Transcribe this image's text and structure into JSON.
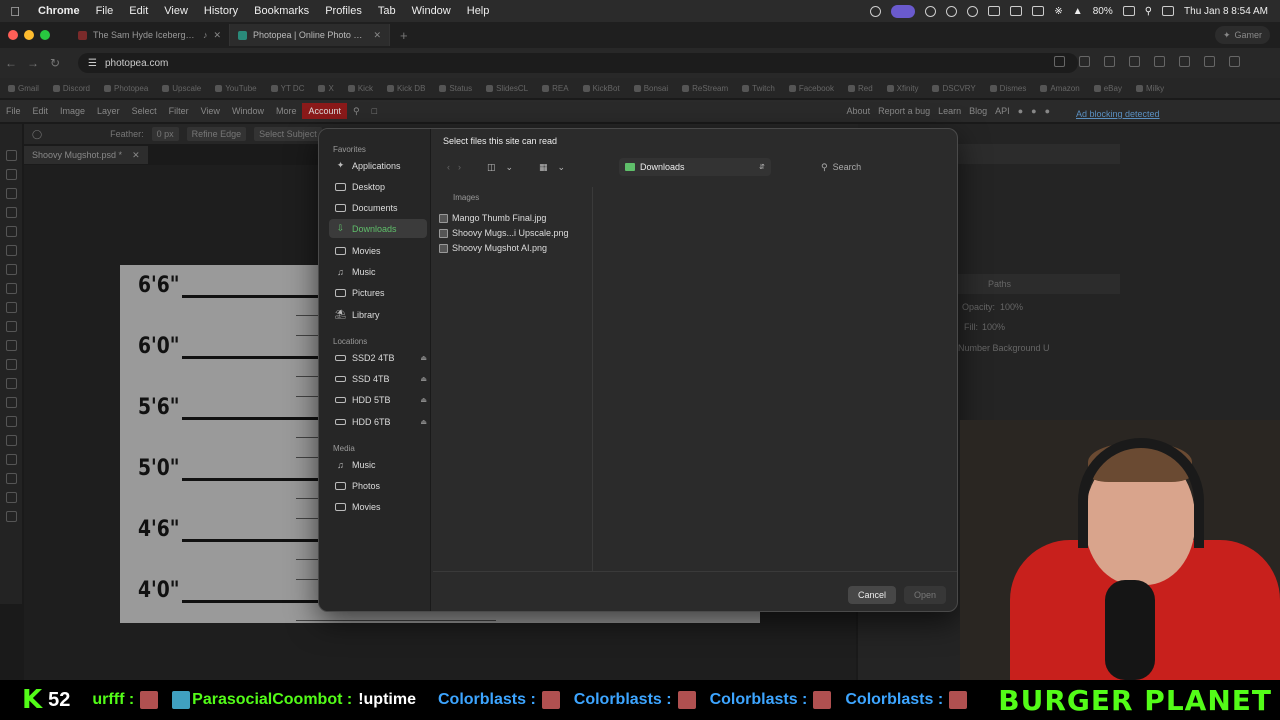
{
  "menubar": {
    "items": [
      "Chrome",
      "File",
      "Edit",
      "View",
      "History",
      "Bookmarks",
      "Profiles",
      "Tab",
      "Window",
      "Help"
    ],
    "battery": "80%",
    "datetime": "Thu Jan 8  8:54 AM"
  },
  "tabs": [
    {
      "title": "The Sam Hyde Iceberg Ex"
    },
    {
      "title": "Photopea | Online Photo Edit"
    }
  ],
  "profile_chip": "Gamer",
  "address": "photopea.com",
  "bookmarks": [
    "Gmail",
    "Discord",
    "Photopea",
    "Upscale",
    "YouTube",
    "YT DC",
    "X",
    "Kick",
    "Kick DB",
    "Status",
    "SlidesCL",
    "REA",
    "KickBot",
    "Bonsai",
    "ReStream",
    "Twitch",
    "Facebook",
    "Red",
    "Xfinity",
    "DSCVRY",
    "Dismes",
    "Amazon",
    "eBay",
    "Milky"
  ],
  "photopea": {
    "menu": [
      "File",
      "Edit",
      "Image",
      "Layer",
      "Select",
      "Filter",
      "View",
      "Window",
      "More"
    ],
    "account": "Account",
    "links": [
      "About",
      "Report a bug",
      "Learn",
      "Blog",
      "API"
    ],
    "adblock": "Ad blocking detected",
    "feather_label": "Feather:",
    "feather_value": "0 px",
    "refine_edge": "Refine Edge",
    "select_subject": "Select Subject",
    "doc_tab": "Shoovy Mugshot.psd *",
    "paths_tab": "Paths",
    "opacity_label": "Opacity:",
    "opacity_value": "100%",
    "fill_label": "Fill:",
    "fill_value": "100%",
    "layer_name": "Number Background U"
  },
  "canvas": {
    "heights": [
      "6'6\"",
      "6'0\"",
      "5'6\"",
      "5'0\"",
      "4'6\"",
      "4'0\""
    ]
  },
  "dialog": {
    "title": "Select files this site can read",
    "location": "Downloads",
    "search_placeholder": "Search",
    "favorites_label": "Favorites",
    "favorites": [
      "Applications",
      "Desktop",
      "Documents",
      "Downloads",
      "Movies",
      "Music",
      "Pictures",
      "Library"
    ],
    "locations_label": "Locations",
    "locations": [
      "SSD2 4TB",
      "SSD 4TB",
      "HDD 5TB",
      "HDD 6TB"
    ],
    "media_label": "Media",
    "media": [
      "Music",
      "Photos",
      "Movies"
    ],
    "column_header": "Images",
    "files": [
      "Mango Thumb Final.jpg",
      "Shoovy Mugs...i Upscale.png",
      "Shoovy Mugshot AI.png"
    ],
    "cancel": "Cancel",
    "open": "Open"
  },
  "ticker": {
    "viewer_count": "52",
    "segments": [
      {
        "text": "urfff :",
        "color": "green"
      },
      {
        "text": "ParasocialCoombot :",
        "color": "green"
      },
      {
        "text": "!uptime",
        "color": "white"
      },
      {
        "text": "Colorblasts :",
        "color": "blue"
      },
      {
        "text": "Colorblasts :",
        "color": "blue"
      },
      {
        "text": "Colorblasts :",
        "color": "blue"
      },
      {
        "text": "Colorblasts :",
        "color": "blue"
      }
    ],
    "banner": "BURGER PLANET"
  },
  "colors": {
    "accent_green": "#53fc18",
    "selection_green": "#5fbf6a",
    "account_red": "#8b1a1a",
    "link_blue": "#5a8fc0",
    "chat_blue": "#3da5ff"
  }
}
